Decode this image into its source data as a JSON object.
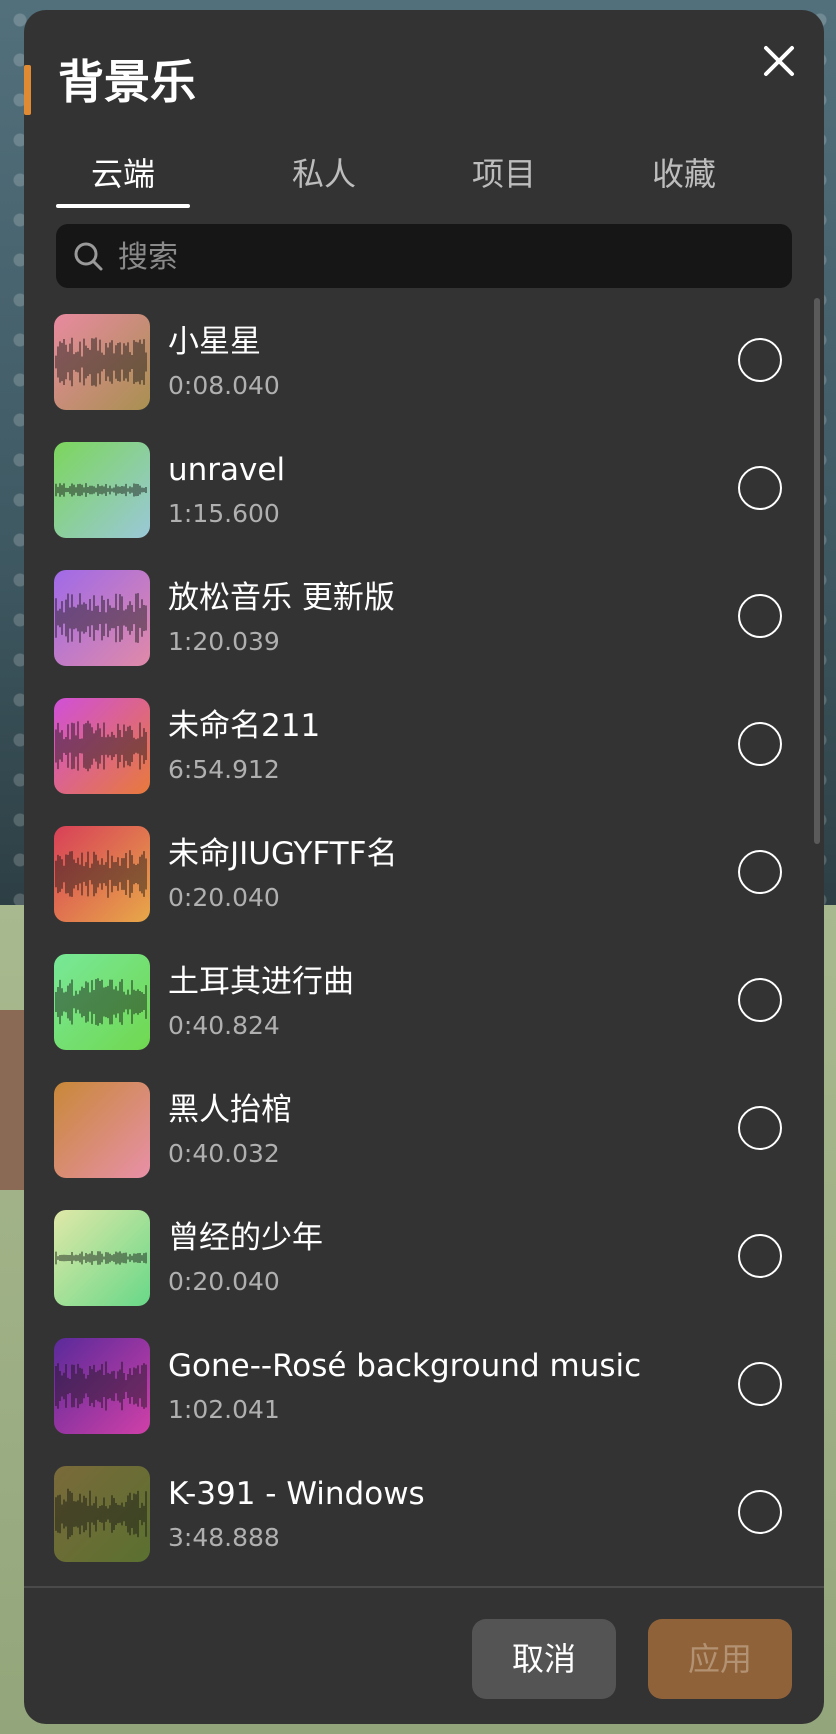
{
  "dialog": {
    "title": "背景乐",
    "accent_color": "#e08a33"
  },
  "tabs": [
    {
      "label": "云端",
      "active": true
    },
    {
      "label": "私人",
      "active": false
    },
    {
      "label": "项目",
      "active": false
    },
    {
      "label": "收藏",
      "active": false
    }
  ],
  "search": {
    "placeholder": "搜索",
    "value": ""
  },
  "songs": [
    {
      "name": "小星星",
      "duration": "0:08.040",
      "thumb_colors": [
        "#e88aa0",
        "#a89050"
      ],
      "selected": false
    },
    {
      "name": "unravel",
      "duration": "1:15.600",
      "thumb_colors": [
        "#7cd65c",
        "#9ac8d8"
      ],
      "selected": false
    },
    {
      "name": "放松音乐 更新版",
      "duration": "1:20.039",
      "thumb_colors": [
        "#a06ae8",
        "#e08aa8"
      ],
      "selected": false
    },
    {
      "name": "未命名211",
      "duration": "6:54.912",
      "thumb_colors": [
        "#d050d8",
        "#e87a3a"
      ],
      "selected": false
    },
    {
      "name": "未命JIUGYFTF名",
      "duration": "0:20.040",
      "thumb_colors": [
        "#d84058",
        "#e8a848"
      ],
      "selected": false
    },
    {
      "name": "土耳其进行曲",
      "duration": "0:40.824",
      "thumb_colors": [
        "#78e898",
        "#70d850"
      ],
      "selected": false
    },
    {
      "name": "黑人抬棺",
      "duration": "0:40.032",
      "thumb_colors": [
        "#c88838",
        "#e890a8"
      ],
      "selected": false
    },
    {
      "name": "曾经的少年",
      "duration": "0:20.040",
      "thumb_colors": [
        "#e0e8a8",
        "#68d888"
      ],
      "selected": false
    },
    {
      "name": "Gone--Rosé background music",
      "duration": "1:02.041",
      "thumb_colors": [
        "#5a2a9a",
        "#d040a8"
      ],
      "selected": false
    },
    {
      "name": "K-391 - Windows",
      "duration": "3:48.888",
      "thumb_colors": [
        "#7a6a3a",
        "#5a7030"
      ],
      "selected": false
    }
  ],
  "footer": {
    "cancel_label": "取消",
    "apply_label": "应用"
  }
}
